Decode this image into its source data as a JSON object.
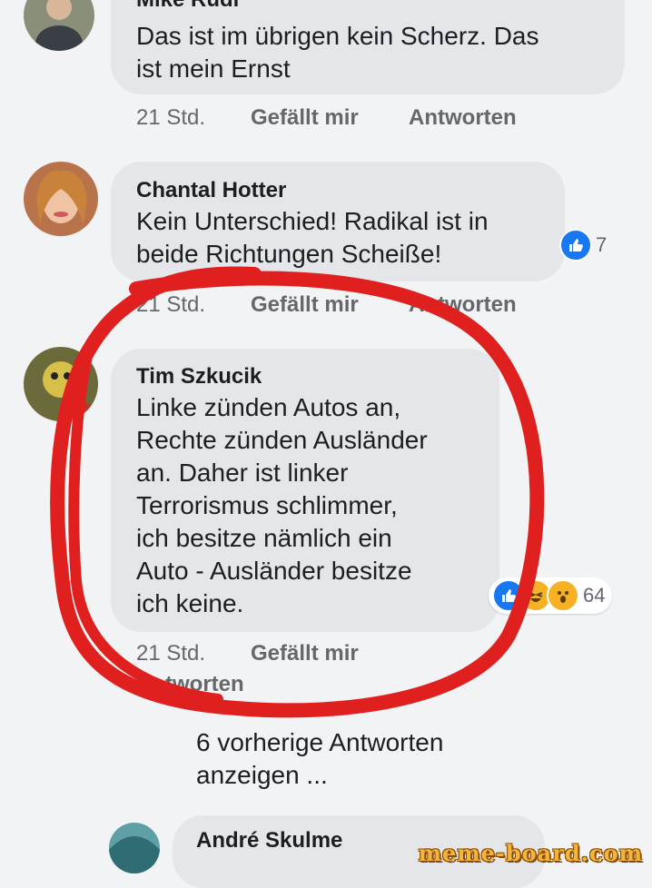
{
  "comments": [
    {
      "author": "Mike Rudi",
      "text": "Das ist im übrigen kein Scherz. Das\nist mein Ernst",
      "time": "21 Std.",
      "like_label": "Gefällt mir",
      "reply_label": "Antworten"
    },
    {
      "author": "Chantal Hotter",
      "text": "Kein Unterschied! Radikal ist in\nbeide Richtungen Scheiße!",
      "time": "21 Std.",
      "like_label": "Gefällt mir",
      "reply_label": "Antworten",
      "reactions": {
        "icons": [
          "like-icon"
        ],
        "count": "7"
      }
    },
    {
      "author": "Tim Szkucik",
      "text": "Linke zünden Autos an,\nRechte zünden Ausländer\nan. Daher ist linker\nTerrorismus schlimmer,\nich besitze nämlich ein\nAuto - Ausländer besitze\nich keine.",
      "time": "21 Std.",
      "like_label": "Gefällt mir",
      "reply_label": "Antworten",
      "reactions": {
        "icons": [
          "like-icon",
          "haha-icon",
          "wow-icon"
        ],
        "count": "64"
      }
    },
    {
      "author": "André Skulme"
    }
  ],
  "view_previous_replies": "6 vorherige Antworten\nanzeigen ...",
  "watermark": "meme-board.com",
  "colors": {
    "bubble": "#e4e6ea",
    "like_blue": "#1877f2",
    "annotation_red": "#e0201e"
  }
}
